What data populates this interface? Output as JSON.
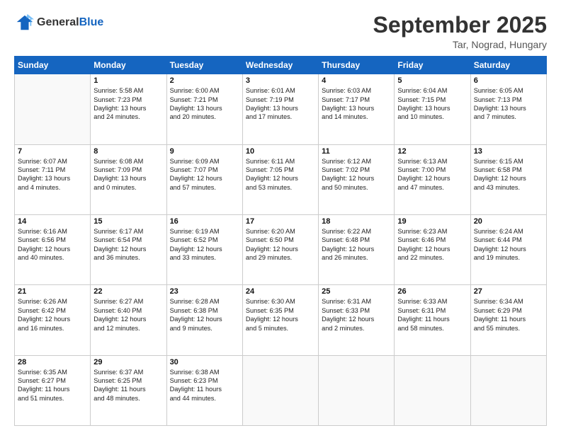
{
  "logo": {
    "line1": "General",
    "line2": "Blue"
  },
  "title": "September 2025",
  "location": "Tar, Nograd, Hungary",
  "days_header": [
    "Sunday",
    "Monday",
    "Tuesday",
    "Wednesday",
    "Thursday",
    "Friday",
    "Saturday"
  ],
  "weeks": [
    [
      {
        "day": "",
        "info": ""
      },
      {
        "day": "1",
        "info": "Sunrise: 5:58 AM\nSunset: 7:23 PM\nDaylight: 13 hours\nand 24 minutes."
      },
      {
        "day": "2",
        "info": "Sunrise: 6:00 AM\nSunset: 7:21 PM\nDaylight: 13 hours\nand 20 minutes."
      },
      {
        "day": "3",
        "info": "Sunrise: 6:01 AM\nSunset: 7:19 PM\nDaylight: 13 hours\nand 17 minutes."
      },
      {
        "day": "4",
        "info": "Sunrise: 6:03 AM\nSunset: 7:17 PM\nDaylight: 13 hours\nand 14 minutes."
      },
      {
        "day": "5",
        "info": "Sunrise: 6:04 AM\nSunset: 7:15 PM\nDaylight: 13 hours\nand 10 minutes."
      },
      {
        "day": "6",
        "info": "Sunrise: 6:05 AM\nSunset: 7:13 PM\nDaylight: 13 hours\nand 7 minutes."
      }
    ],
    [
      {
        "day": "7",
        "info": "Sunrise: 6:07 AM\nSunset: 7:11 PM\nDaylight: 13 hours\nand 4 minutes."
      },
      {
        "day": "8",
        "info": "Sunrise: 6:08 AM\nSunset: 7:09 PM\nDaylight: 13 hours\nand 0 minutes."
      },
      {
        "day": "9",
        "info": "Sunrise: 6:09 AM\nSunset: 7:07 PM\nDaylight: 12 hours\nand 57 minutes."
      },
      {
        "day": "10",
        "info": "Sunrise: 6:11 AM\nSunset: 7:05 PM\nDaylight: 12 hours\nand 53 minutes."
      },
      {
        "day": "11",
        "info": "Sunrise: 6:12 AM\nSunset: 7:02 PM\nDaylight: 12 hours\nand 50 minutes."
      },
      {
        "day": "12",
        "info": "Sunrise: 6:13 AM\nSunset: 7:00 PM\nDaylight: 12 hours\nand 47 minutes."
      },
      {
        "day": "13",
        "info": "Sunrise: 6:15 AM\nSunset: 6:58 PM\nDaylight: 12 hours\nand 43 minutes."
      }
    ],
    [
      {
        "day": "14",
        "info": "Sunrise: 6:16 AM\nSunset: 6:56 PM\nDaylight: 12 hours\nand 40 minutes."
      },
      {
        "day": "15",
        "info": "Sunrise: 6:17 AM\nSunset: 6:54 PM\nDaylight: 12 hours\nand 36 minutes."
      },
      {
        "day": "16",
        "info": "Sunrise: 6:19 AM\nSunset: 6:52 PM\nDaylight: 12 hours\nand 33 minutes."
      },
      {
        "day": "17",
        "info": "Sunrise: 6:20 AM\nSunset: 6:50 PM\nDaylight: 12 hours\nand 29 minutes."
      },
      {
        "day": "18",
        "info": "Sunrise: 6:22 AM\nSunset: 6:48 PM\nDaylight: 12 hours\nand 26 minutes."
      },
      {
        "day": "19",
        "info": "Sunrise: 6:23 AM\nSunset: 6:46 PM\nDaylight: 12 hours\nand 22 minutes."
      },
      {
        "day": "20",
        "info": "Sunrise: 6:24 AM\nSunset: 6:44 PM\nDaylight: 12 hours\nand 19 minutes."
      }
    ],
    [
      {
        "day": "21",
        "info": "Sunrise: 6:26 AM\nSunset: 6:42 PM\nDaylight: 12 hours\nand 16 minutes."
      },
      {
        "day": "22",
        "info": "Sunrise: 6:27 AM\nSunset: 6:40 PM\nDaylight: 12 hours\nand 12 minutes."
      },
      {
        "day": "23",
        "info": "Sunrise: 6:28 AM\nSunset: 6:38 PM\nDaylight: 12 hours\nand 9 minutes."
      },
      {
        "day": "24",
        "info": "Sunrise: 6:30 AM\nSunset: 6:35 PM\nDaylight: 12 hours\nand 5 minutes."
      },
      {
        "day": "25",
        "info": "Sunrise: 6:31 AM\nSunset: 6:33 PM\nDaylight: 12 hours\nand 2 minutes."
      },
      {
        "day": "26",
        "info": "Sunrise: 6:33 AM\nSunset: 6:31 PM\nDaylight: 11 hours\nand 58 minutes."
      },
      {
        "day": "27",
        "info": "Sunrise: 6:34 AM\nSunset: 6:29 PM\nDaylight: 11 hours\nand 55 minutes."
      }
    ],
    [
      {
        "day": "28",
        "info": "Sunrise: 6:35 AM\nSunset: 6:27 PM\nDaylight: 11 hours\nand 51 minutes."
      },
      {
        "day": "29",
        "info": "Sunrise: 6:37 AM\nSunset: 6:25 PM\nDaylight: 11 hours\nand 48 minutes."
      },
      {
        "day": "30",
        "info": "Sunrise: 6:38 AM\nSunset: 6:23 PM\nDaylight: 11 hours\nand 44 minutes."
      },
      {
        "day": "",
        "info": ""
      },
      {
        "day": "",
        "info": ""
      },
      {
        "day": "",
        "info": ""
      },
      {
        "day": "",
        "info": ""
      }
    ]
  ]
}
